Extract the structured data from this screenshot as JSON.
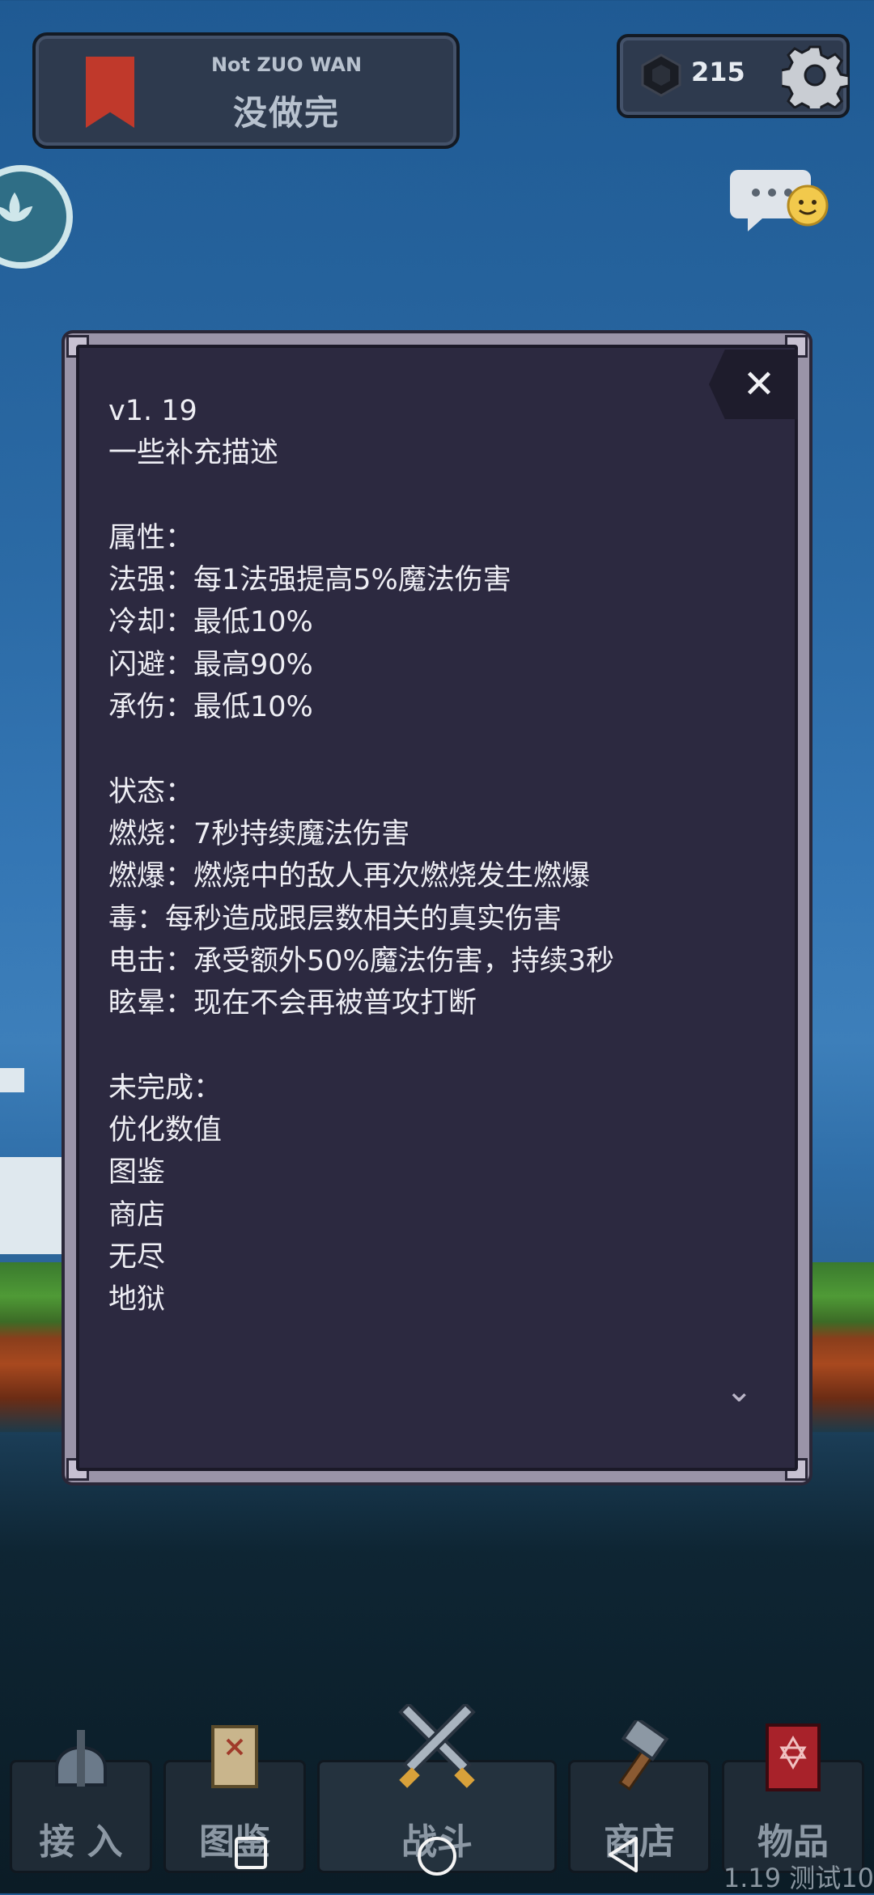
{
  "header": {
    "title_en": "Not ZUO WAN",
    "title_zh": "没做完",
    "bookmark_color": "#c0392b"
  },
  "currency": {
    "gem_count": "215",
    "gem_icon": "gem-icon",
    "settings_icon": "gear-icon"
  },
  "side": {
    "left_icon": "lotus-icon",
    "chat_icon": "chat-emoji-icon"
  },
  "dialog": {
    "close_label": "✕",
    "lines": [
      "v1. 19",
      "一些补充描述",
      "",
      "属性：",
      "法强：每1法强提高5%魔法伤害",
      "冷却：最低10%",
      "闪避：最高90%",
      "承伤：最低10%",
      "",
      "状态：",
      "燃烧：7秒持续魔法伤害",
      "燃爆：燃烧中的敌人再次燃烧发生燃爆",
      "毒：每秒造成跟层数相关的真实伤害",
      "电击：承受额外50%魔法伤害，持续3秒",
      "眩晕：现在不会再被普攻打断",
      "",
      "未完成：",
      "优化数值",
      "图鉴",
      "商店",
      "无尽",
      "地狱"
    ],
    "scroll_icon": "chevron-down-icon"
  },
  "nav": {
    "items": [
      {
        "label": "接 入",
        "icon": "helmet-icon"
      },
      {
        "label": "图鉴",
        "icon": "scroll-icon"
      },
      {
        "label": "战斗",
        "icon": "crossed-swords-icon"
      },
      {
        "label": "商店",
        "icon": "hammer-icon"
      },
      {
        "label": "物品",
        "icon": "spellbook-icon"
      }
    ]
  },
  "version": "1.19 测试10"
}
